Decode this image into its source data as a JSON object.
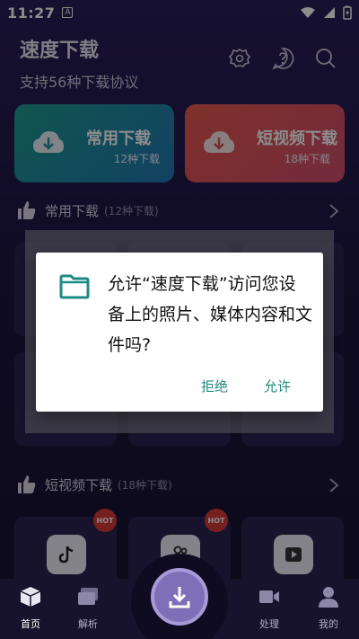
{
  "status_bar": {
    "time": "11:27",
    "badge": "A"
  },
  "header": {
    "title": "速度下载",
    "subtitle": "支持56种下载协议"
  },
  "header_icons": [
    "settings-gear-icon",
    "help-icon",
    "search-icon"
  ],
  "cards": [
    {
      "title": "常用下载",
      "subtitle": "12种下载",
      "color": "#1f9c8f"
    },
    {
      "title": "短视频下载",
      "subtitle": "18种下载",
      "color": "#e6584e"
    }
  ],
  "sections": {
    "common": {
      "title": "常用下载",
      "count": "(12种下载)"
    },
    "short_video": {
      "title": "短视频下载",
      "count": "(18种下载)"
    }
  },
  "hot_badge": "HOT",
  "dialog": {
    "message": "允许“速度下载”访问您设备上的照片、媒体内容和文件吗?",
    "deny_label": "拒绝",
    "allow_label": "允许",
    "accent": "#21897e"
  },
  "bottom_nav": [
    {
      "label": "首页",
      "icon": "home-cube-icon",
      "active": true
    },
    {
      "label": "解析",
      "icon": "cards-icon",
      "active": false
    },
    {
      "label": "处理",
      "icon": "video-camera-icon",
      "active": false
    },
    {
      "label": "我的",
      "icon": "user-icon",
      "active": false
    }
  ]
}
